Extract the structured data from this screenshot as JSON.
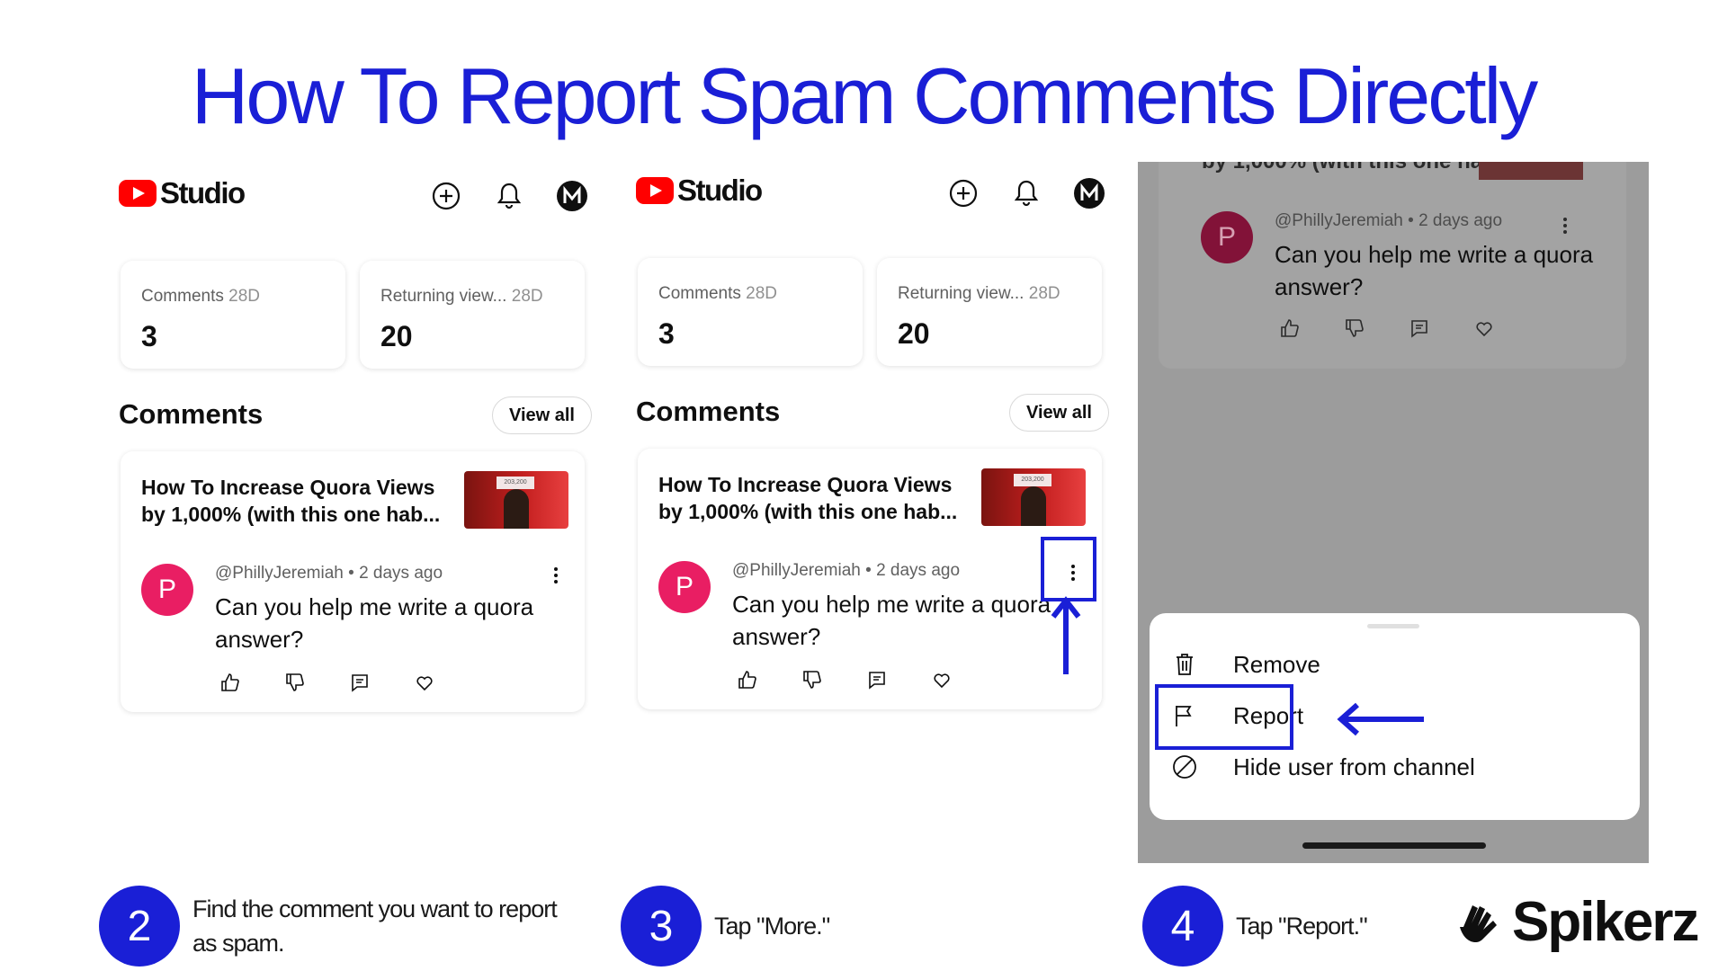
{
  "title": "How To Report Spam Comments Directly",
  "colors": {
    "accent": "#1a1fd6",
    "youtube_red": "#ff0000",
    "avatar_pink": "#e91e63"
  },
  "studio": {
    "logo_text": "Studio",
    "top_icons": [
      "create-icon",
      "notifications-bell-icon",
      "account-avatar-icon"
    ],
    "stats": [
      {
        "label": "Comments",
        "period": "28D",
        "value": "3"
      },
      {
        "label": "Returning view...",
        "period": "28D",
        "value": "20"
      }
    ],
    "section_title": "Comments",
    "view_all": "View all",
    "video_title": "How To Increase Quora Views by 1,000% (with this one hab...",
    "video_title_partial": "by 1,000% (with this one hab...",
    "thumb_badge": "203,200",
    "comment": {
      "avatar_letter": "P",
      "author": "@PhillyJeremiah",
      "separator": "•",
      "time": "2 days ago",
      "text": "Can you help me write a quora answer?",
      "actions": [
        "like-icon",
        "dislike-icon",
        "reply-icon",
        "heart-icon"
      ]
    }
  },
  "menu": {
    "items": [
      {
        "label": "Remove",
        "icon": "trash-icon"
      },
      {
        "label": "Report",
        "icon": "flag-icon"
      },
      {
        "label": "Hide user from channel",
        "icon": "block-icon"
      }
    ]
  },
  "steps": [
    {
      "number": "2",
      "text": "Find the comment you want to report as spam."
    },
    {
      "number": "3",
      "text": "Tap \"More.\""
    },
    {
      "number": "4",
      "text": "Tap \"Report.\""
    }
  ],
  "brand": {
    "name": "Spikerz"
  }
}
